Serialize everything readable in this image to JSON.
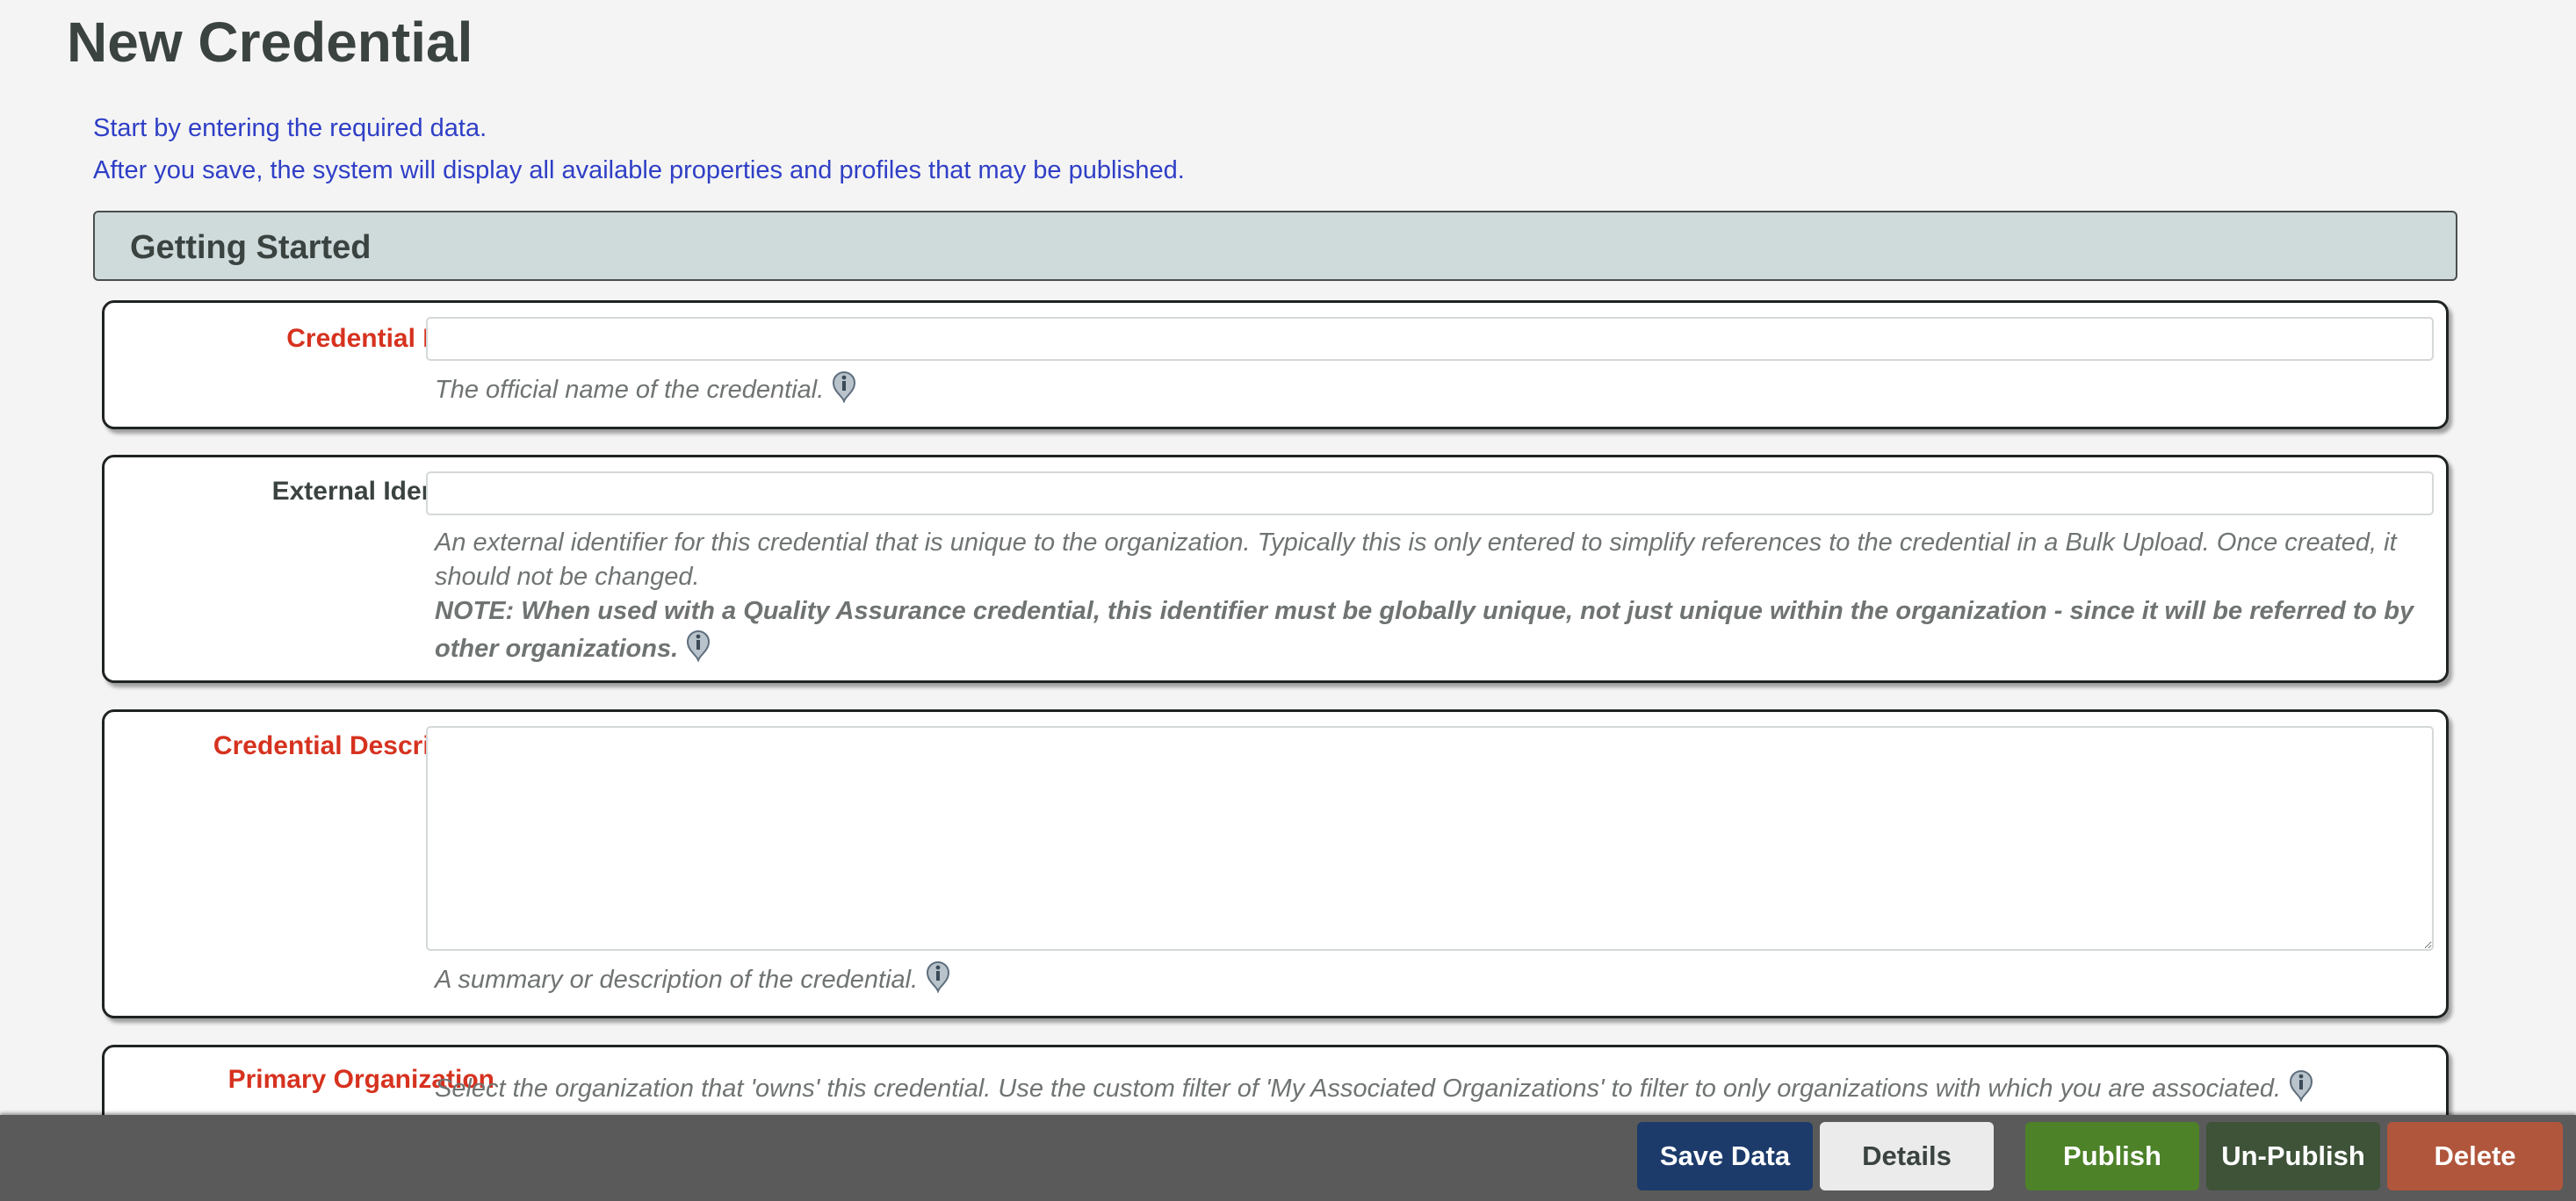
{
  "page": {
    "title": "New Credential",
    "intro_line_1": "Start by entering the required data.",
    "intro_line_2": "After you save, the system will display all available properties and profiles that may be published."
  },
  "section": {
    "title": "Getting Started"
  },
  "fields": {
    "credential_name": {
      "label": "Credential Name",
      "value": "",
      "placeholder": "",
      "help": "The official name of the credential."
    },
    "external_identifier": {
      "label": "External Identifier",
      "value": "",
      "placeholder": "",
      "help": "An external identifier for this credential that is unique to the organization. Typically this is only entered to simplify references to the credential in a Bulk Upload. Once created, it should not be changed.",
      "note": "NOTE: When used with a Quality Assurance credential, this identifier must be globally unique, not just unique within the organization - since it will be referred to by other organizations."
    },
    "credential_description": {
      "label": "Credential Description",
      "value": "",
      "placeholder": "",
      "help": "A summary or description of the credential."
    },
    "primary_organization": {
      "label": "Primary Organization",
      "help": "Select the organization that 'owns' this credential. Use the custom filter of 'My Associated Organizations' to filter to only organizations with which you are associated."
    }
  },
  "icons": {
    "info": "info-icon"
  },
  "colors": {
    "required_label": "#d6321f",
    "intro_text": "#2f3fc6",
    "section_header_bg": "#cfdadb",
    "save_button": "#1c3b6b",
    "publish_button": "#4d8229",
    "unpublish_button": "#3e5338",
    "delete_button": "#b0563c"
  },
  "footer": {
    "save_label": "Save Data",
    "details_label": "Details",
    "publish_label": "Publish",
    "unpublish_label": "Un-Publish",
    "delete_label": "Delete"
  }
}
